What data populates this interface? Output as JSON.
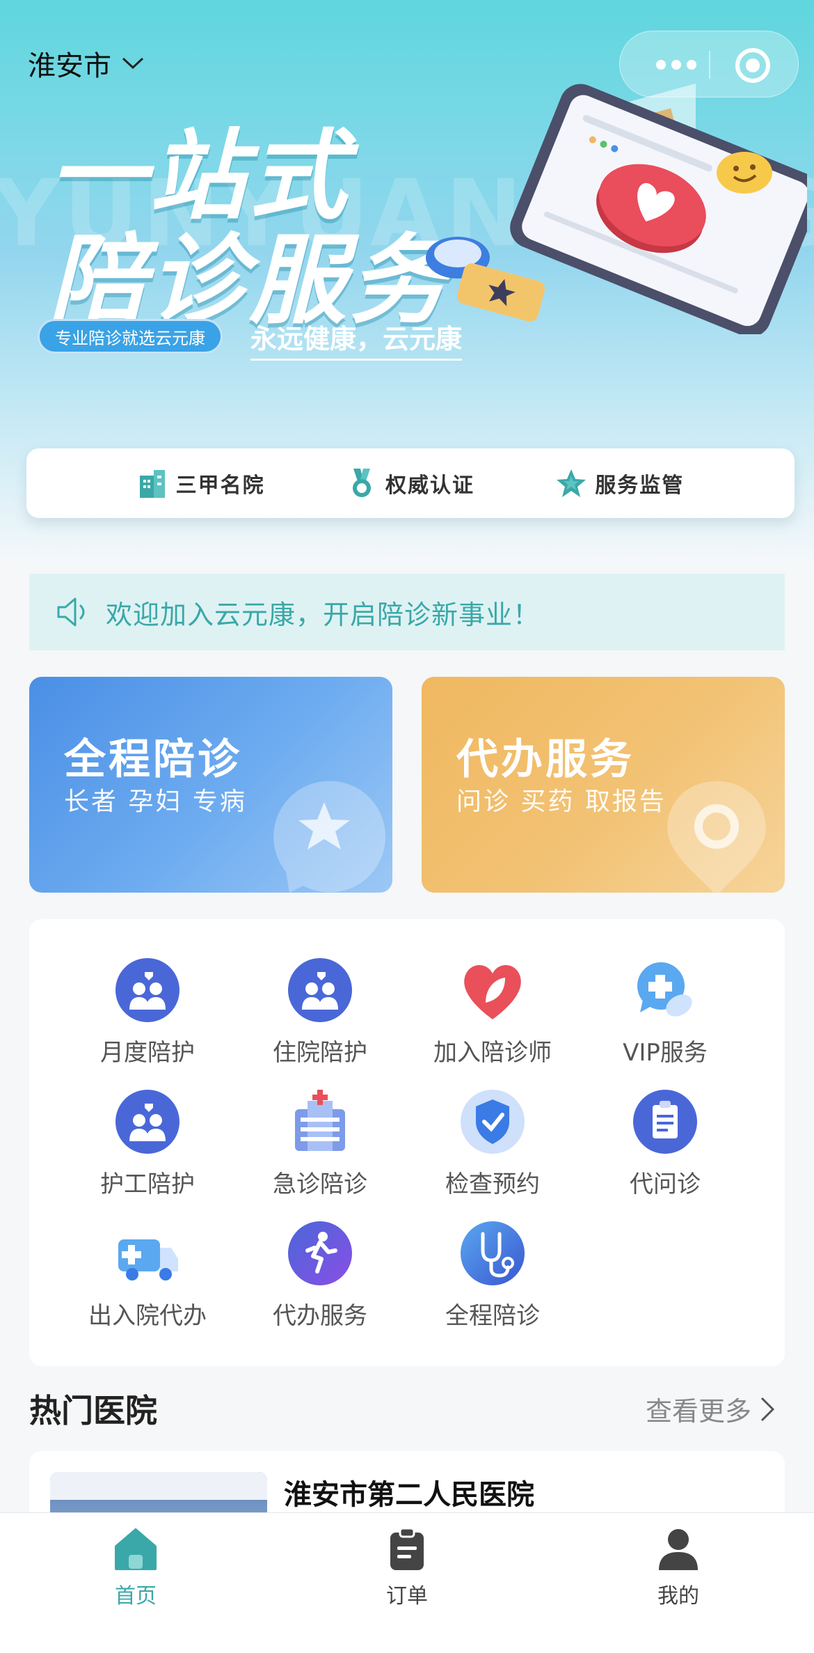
{
  "location": {
    "city": "淮安市"
  },
  "hero": {
    "title_line1": "一站式",
    "title_line2": "陪诊服务",
    "watermark": "YUNYUANKANG",
    "tag": "专业陪诊就选云元康",
    "slogan": "永远健康，云元康"
  },
  "badges": [
    {
      "label": "三甲名院",
      "icon": "hospital-building-icon"
    },
    {
      "label": "权威认证",
      "icon": "medal-icon"
    },
    {
      "label": "服务监管",
      "icon": "star-badge-icon"
    }
  ],
  "notice": {
    "text": "欢迎加入云元康，开启陪诊新事业！"
  },
  "feature_cards": [
    {
      "title": "全程陪诊",
      "subtitle": "长者 孕妇 专病",
      "color": "#4a8fe6"
    },
    {
      "title": "代办服务",
      "subtitle": "问诊 买药 取报告",
      "color": "#f0b860"
    }
  ],
  "services": [
    {
      "label": "月度陪护",
      "icon": "caregivers-icon"
    },
    {
      "label": "住院陪护",
      "icon": "caregivers-icon"
    },
    {
      "label": "加入陪诊师",
      "icon": "heart-leaf-icon"
    },
    {
      "label": "VIP服务",
      "icon": "chat-plus-icon"
    },
    {
      "label": "护工陪护",
      "icon": "caregivers-icon"
    },
    {
      "label": "急诊陪诊",
      "icon": "hospital-icon"
    },
    {
      "label": "检查预约",
      "icon": "shield-check-icon"
    },
    {
      "label": "代问诊",
      "icon": "clipboard-icon"
    },
    {
      "label": "出入院代办",
      "icon": "ambulance-icon"
    },
    {
      "label": "代办服务",
      "icon": "runner-icon"
    },
    {
      "label": "全程陪诊",
      "icon": "stethoscope-icon"
    }
  ],
  "hot_hospitals": {
    "title": "热门医院",
    "more": "查看更多",
    "items": [
      {
        "name": "淮安市第二人民医院"
      }
    ]
  },
  "tabbar": [
    {
      "label": "首页",
      "icon": "home-icon",
      "active": true
    },
    {
      "label": "订单",
      "icon": "clipboard-order-icon",
      "active": false
    },
    {
      "label": "我的",
      "icon": "user-icon",
      "active": false
    }
  ],
  "colors": {
    "accent": "#3aa8a8",
    "blue": "#4a8fe6",
    "orange": "#f0b860",
    "icon_blue": "#4a67d8",
    "icon_red": "#e9505a"
  }
}
